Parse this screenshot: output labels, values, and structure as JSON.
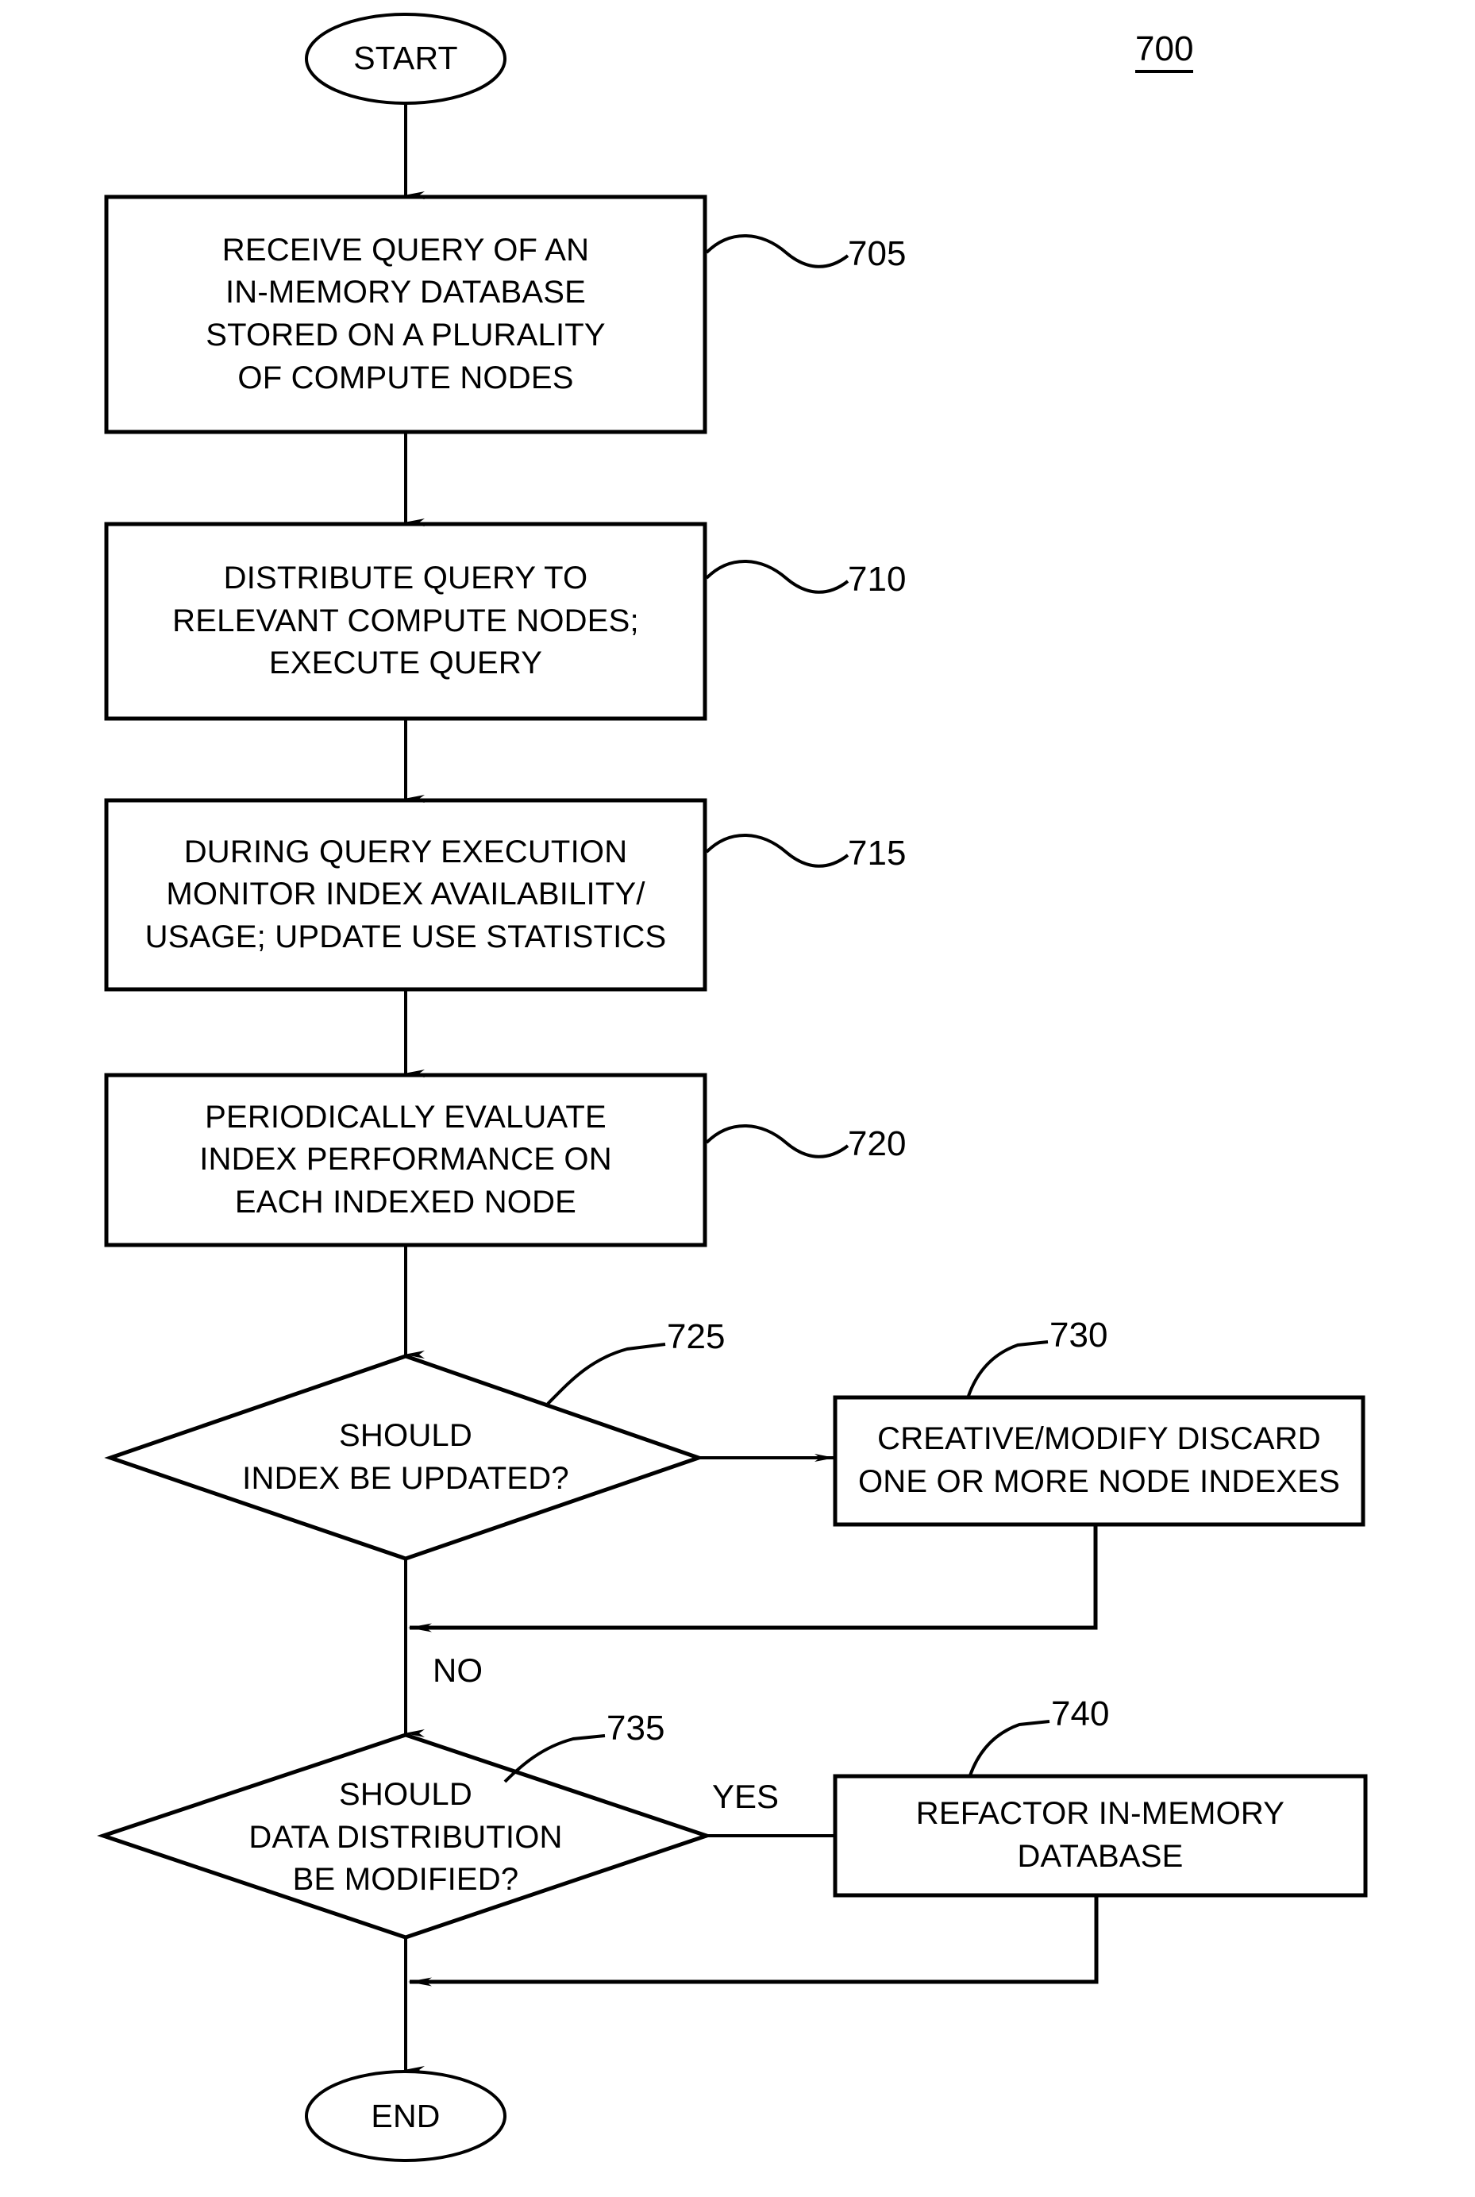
{
  "figure": {
    "number": "700",
    "type": "flowchart"
  },
  "nodes": {
    "start": {
      "id": "start",
      "shape": "ellipse",
      "label": "START"
    },
    "step705": {
      "id": "705",
      "shape": "process",
      "ref": "705",
      "lines": [
        "RECEIVE QUERY OF AN",
        "IN-MEMORY DATABASE",
        "STORED ON A PLURALITY",
        "OF COMPUTE NODES"
      ]
    },
    "step710": {
      "id": "710",
      "shape": "process",
      "ref": "710",
      "lines": [
        "DISTRIBUTE QUERY TO",
        "RELEVANT COMPUTE NODES;",
        "EXECUTE QUERY"
      ]
    },
    "step715": {
      "id": "715",
      "shape": "process",
      "ref": "715",
      "lines": [
        "DURING QUERY EXECUTION",
        "MONITOR INDEX AVAILABILITY/",
        "USAGE; UPDATE USE STATISTICS"
      ]
    },
    "step720": {
      "id": "720",
      "shape": "process",
      "ref": "720",
      "lines": [
        "PERIODICALLY EVALUATE",
        "INDEX PERFORMANCE ON",
        "EACH INDEXED NODE"
      ]
    },
    "decision725": {
      "id": "725",
      "shape": "decision",
      "ref": "725",
      "lines": [
        "SHOULD",
        "INDEX BE UPDATED?"
      ]
    },
    "step730": {
      "id": "730",
      "shape": "process",
      "ref": "730",
      "lines": [
        "CREATIVE/MODIFY DISCARD",
        "ONE OR MORE NODE INDEXES"
      ]
    },
    "decision735": {
      "id": "735",
      "shape": "decision",
      "ref": "735",
      "lines": [
        "SHOULD",
        "DATA DISTRIBUTION",
        "BE MODIFIED?"
      ]
    },
    "step740": {
      "id": "740",
      "shape": "process",
      "ref": "740",
      "lines": [
        "REFACTOR IN-MEMORY",
        "DATABASE"
      ]
    },
    "end": {
      "id": "end",
      "shape": "ellipse",
      "label": "END"
    }
  },
  "edge_labels": {
    "no_branch": "NO",
    "yes_branch": "YES"
  },
  "colors": {
    "stroke": "#000000",
    "fill": "#ffffff",
    "text": "#000000"
  }
}
